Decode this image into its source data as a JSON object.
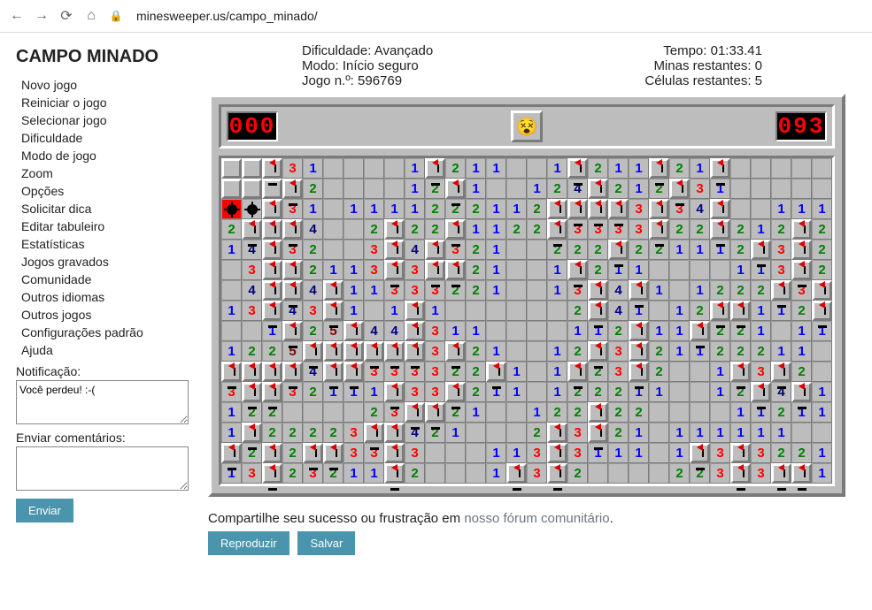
{
  "browser": {
    "url": "minesweeper.us/campo_minado/"
  },
  "sidebar": {
    "title": "CAMPO MINADO",
    "menu": [
      "Novo jogo",
      "Reiniciar o jogo",
      "Selecionar jogo",
      "Dificuldade",
      "Modo de jogo",
      "Zoom",
      "Opções",
      "Solicitar dica",
      "Editar tabuleiro",
      "Estatísticas",
      "Jogos gravados",
      "Comunidade",
      "Outros idiomas",
      "Outros jogos",
      "Configurações padrão",
      "Ajuda"
    ],
    "notification_label": "Notificação:",
    "notification_value": "Você perdeu! :-(",
    "comments_label": "Enviar comentários:",
    "comments_value": "",
    "send_label": "Enviar"
  },
  "info": {
    "rows": [
      {
        "left": "Dificuldade: Avançado",
        "right": "Tempo: 01:33.41"
      },
      {
        "left": "Modo: Início seguro",
        "right": "Minas restantes: 0"
      },
      {
        "left": "Jogo n.º: 596769",
        "right": "Células restantes: 5"
      }
    ]
  },
  "counters": {
    "mines": "000",
    "time": "093"
  },
  "face": "dead",
  "share": {
    "prefix": "Compartilhe seu sucesso ou frustração em ",
    "link_text": "nosso fórum comunitário",
    "suffix": "."
  },
  "buttons": {
    "reproduce": "Reproduzir",
    "save": "Salvar"
  },
  "board": {
    "cols": 30,
    "rows": 16,
    "cells": [
      [
        "U",
        "U",
        "F",
        "3",
        "1",
        "",
        "",
        "",
        "",
        "1",
        "F",
        "2",
        "1",
        "1",
        "",
        "",
        "1",
        "F",
        "2",
        "1",
        "1",
        "F",
        "2",
        "1",
        "F",
        "",
        "",
        "",
        "",
        ""
      ],
      [
        "U",
        "U",
        "U",
        "F",
        "2",
        "",
        "",
        "",
        "",
        "1",
        "2",
        "F",
        "1",
        "",
        "",
        "1",
        "2",
        "4",
        "F",
        "2",
        "1",
        "2",
        "F",
        "3",
        "1",
        "",
        "",
        "",
        "",
        ""
      ],
      [
        "X",
        "M",
        "F",
        "3",
        "1",
        "",
        "1",
        "1",
        "1",
        "1",
        "2",
        "2",
        "2",
        "1",
        "1",
        "2",
        "F",
        "F",
        "F",
        "F",
        "3",
        "F",
        "3",
        "4",
        "F",
        "",
        "",
        "1",
        "1",
        "1"
      ],
      [
        "2",
        "F",
        "F",
        "F",
        "4",
        "",
        "",
        "2",
        "F",
        "2",
        "2",
        "F",
        "1",
        "1",
        "2",
        "2",
        "F",
        "3",
        "3",
        "3",
        "3",
        "F",
        "2",
        "2",
        "F",
        "2",
        "1",
        "2",
        "F",
        "2"
      ],
      [
        "1",
        "4",
        "F",
        "3",
        "2",
        "",
        "",
        "3",
        "F",
        "4",
        "F",
        "3",
        "2",
        "1",
        "",
        "",
        "2",
        "2",
        "2",
        "F",
        "2",
        "2",
        "1",
        "1",
        "1",
        "2",
        "F",
        "3",
        "F",
        "2"
      ],
      [
        "",
        "3",
        "F",
        "F",
        "2",
        "1",
        "1",
        "3",
        "F",
        "3",
        "F",
        "F",
        "2",
        "1",
        "",
        "",
        "1",
        "F",
        "2",
        "1",
        "1",
        "",
        "",
        "",
        "",
        "1",
        "1",
        "3",
        "F",
        "2"
      ],
      [
        "",
        "4",
        "F",
        "F",
        "4",
        "F",
        "1",
        "1",
        "3",
        "3",
        "3",
        "2",
        "2",
        "1",
        "",
        "",
        "1",
        "3",
        "F",
        "4",
        "F",
        "1",
        "",
        "1",
        "2",
        "2",
        "2",
        "F",
        "3",
        "F"
      ],
      [
        "1",
        "3",
        "F",
        "4",
        "3",
        "F",
        "1",
        "",
        "1",
        "F",
        "1",
        "",
        "",
        "",
        "",
        "",
        "",
        "2",
        "F",
        "4",
        "1",
        "",
        "1",
        "2",
        "F",
        "F",
        "1",
        "1",
        "2",
        "F"
      ],
      [
        "",
        "",
        "1",
        "F",
        "2",
        "5",
        "F",
        "4",
        "4",
        "F",
        "3",
        "1",
        "1",
        "",
        "",
        "",
        "",
        "1",
        "1",
        "2",
        "F",
        "1",
        "1",
        "F",
        "2",
        "2",
        "1",
        "",
        "1",
        "1"
      ],
      [
        "1",
        "2",
        "2",
        "5",
        "F",
        "F",
        "F",
        "F",
        "F",
        "F",
        "3",
        "F",
        "2",
        "1",
        "",
        "",
        "1",
        "2",
        "F",
        "3",
        "F",
        "2",
        "1",
        "1",
        "2",
        "2",
        "2",
        "1",
        "1",
        ""
      ],
      [
        "F",
        "F",
        "F",
        "F",
        "4",
        "F",
        "F",
        "3",
        "3",
        "3",
        "3",
        "2",
        "2",
        "F",
        "1",
        "",
        "1",
        "F",
        "2",
        "3",
        "F",
        "2",
        "",
        "",
        "1",
        "F",
        "3",
        "F",
        "2",
        ""
      ],
      [
        "3",
        "F",
        "F",
        "3",
        "2",
        "1",
        "1",
        "1",
        "F",
        "3",
        "3",
        "F",
        "2",
        "1",
        "1",
        "",
        "1",
        "2",
        "2",
        "2",
        "1",
        "1",
        "",
        "",
        "1",
        "2",
        "F",
        "4",
        "F",
        "1"
      ],
      [
        "1",
        "2",
        "2",
        "",
        "",
        "",
        "",
        "2",
        "3",
        "F",
        "F",
        "2",
        "1",
        "",
        "",
        "1",
        "2",
        "2",
        "F",
        "2",
        "2",
        "",
        "",
        "",
        "",
        "1",
        "1",
        "2",
        "1",
        "1"
      ],
      [
        "1",
        "F",
        "2",
        "2",
        "2",
        "2",
        "3",
        "F",
        "F",
        "4",
        "2",
        "1",
        "",
        "",
        "",
        "2",
        "F",
        "3",
        "F",
        "2",
        "1",
        "",
        "1",
        "1",
        "1",
        "1",
        "1",
        "1",
        "",
        ""
      ],
      [
        "F",
        "2",
        "F",
        "2",
        "F",
        "F",
        "3",
        "3",
        "F",
        "3",
        "",
        "",
        "",
        "1",
        "1",
        "3",
        "F",
        "3",
        "1",
        "1",
        "1",
        "",
        "1",
        "F",
        "3",
        "F",
        "3",
        "2",
        "2",
        "1"
      ],
      [
        "1",
        "3",
        "F",
        "2",
        "3",
        "2",
        "1",
        "1",
        "F",
        "2",
        "",
        "",
        "",
        "1",
        "F",
        "3",
        "F",
        "2",
        "",
        "",
        "",
        "",
        "2",
        "2",
        "3",
        "F",
        "3",
        "F",
        "F",
        "1"
      ]
    ]
  }
}
